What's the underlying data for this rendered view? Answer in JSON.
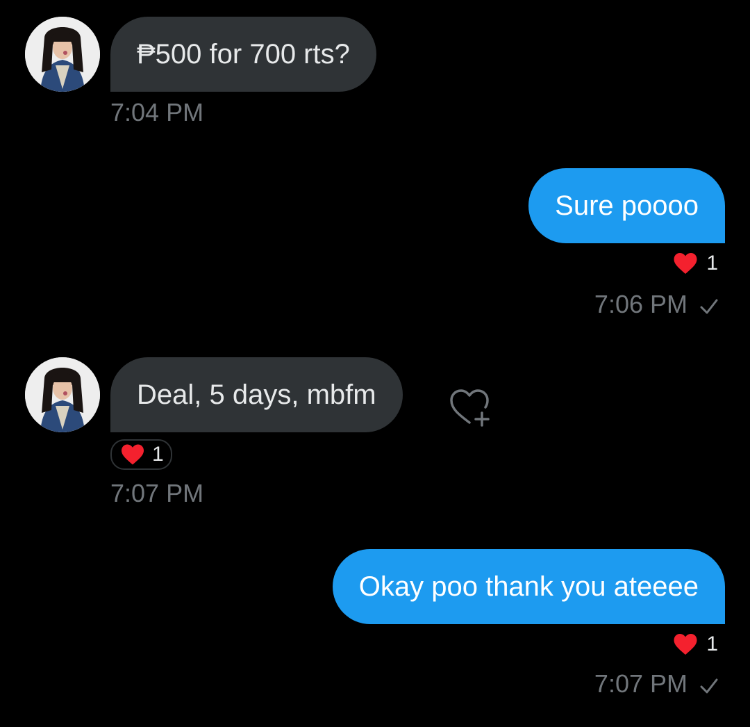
{
  "conversation": {
    "messages": [
      {
        "sender": "other",
        "text": "₱500 for 700 rts?",
        "time": "7:04 PM"
      },
      {
        "sender": "me",
        "text": "Sure poooo",
        "reaction_count": "1",
        "time": "7:06 PM"
      },
      {
        "sender": "other",
        "text": "Deal, 5 days, mbfm",
        "reaction_count": "1",
        "time": "7:07 PM"
      },
      {
        "sender": "me",
        "text": "Okay poo thank you ateeee",
        "reaction_count": "1",
        "time": "7:07 PM"
      }
    ]
  },
  "icons": {
    "reaction": "heart-icon",
    "add_reaction": "heart-plus-icon",
    "sent": "checkmark-icon"
  },
  "colors": {
    "background": "#000000",
    "incoming_bubble": "#2f3336",
    "outgoing_bubble": "#1d9bf0",
    "heart": "#f4212e",
    "timestamp": "#71767b"
  }
}
